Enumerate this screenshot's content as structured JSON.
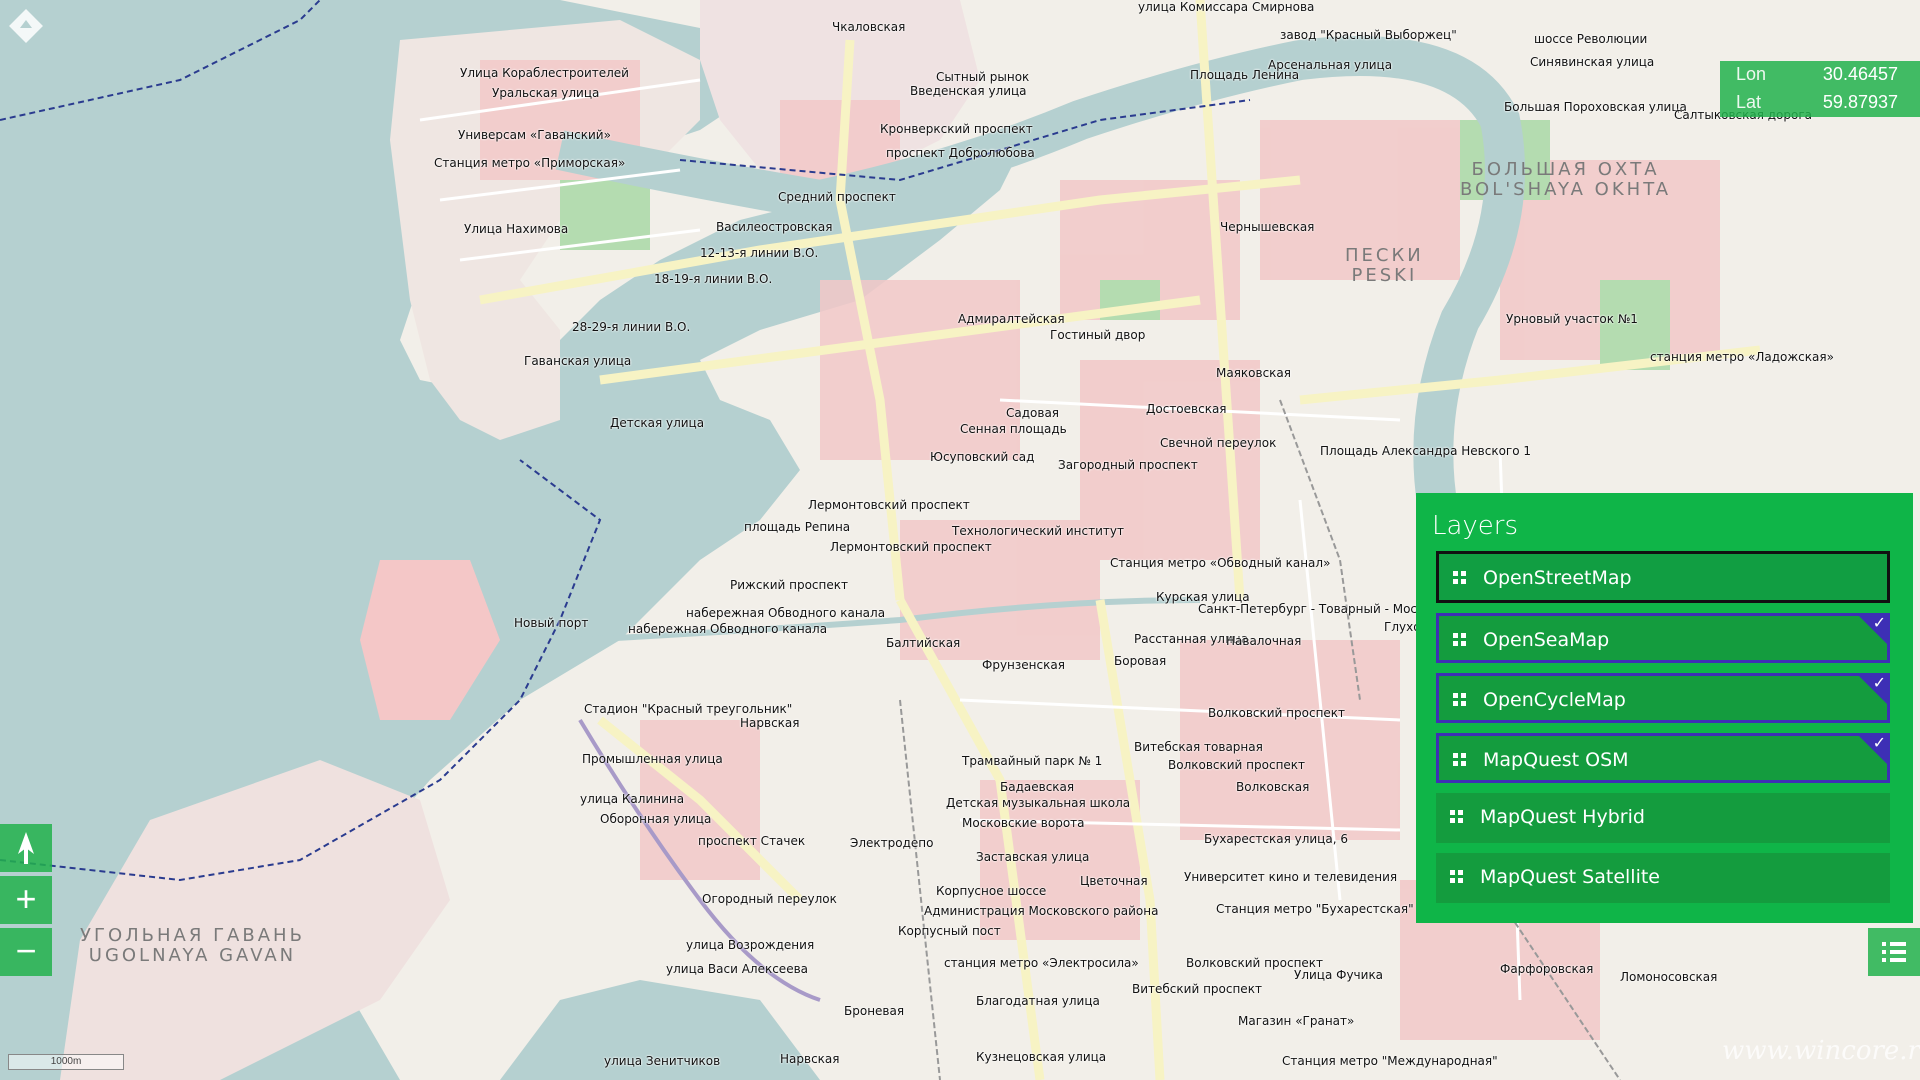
{
  "coordinates": {
    "lon_label": "Lon",
    "lon_value": "30.46457",
    "lat_label": "Lat",
    "lat_value": "59.87937"
  },
  "layers_panel": {
    "title": "Layers",
    "items": [
      {
        "label": "OpenStreetMap",
        "state": "selected"
      },
      {
        "label": "OpenSeaMap",
        "state": "checked"
      },
      {
        "label": "OpenCycleMap",
        "state": "checked"
      },
      {
        "label": "MapQuest OSM",
        "state": "checked"
      },
      {
        "label": "MapQuest Hybrid",
        "state": "normal"
      },
      {
        "label": "MapQuest Satellite",
        "state": "normal"
      }
    ]
  },
  "controls": {
    "zoom_in": "+",
    "zoom_out": "−",
    "north_arrow_icon": "north-arrow-icon",
    "layers_icon": "list-icon"
  },
  "scale": "1000m",
  "watermark": "www.wincore.ru",
  "map": {
    "districts": [
      {
        "name": "БОЛЬШАЯ ОХТА",
        "name2": "BOL'SHAYA OKHTA"
      },
      {
        "name": "ПЕСКИ",
        "name2": "PESKI"
      },
      {
        "name": "УГОЛЬНАЯ ГАВАНЬ",
        "name2": "UGOLNAYA GAVAN"
      }
    ],
    "labels": [
      "улица Комиссара Смирнова",
      "завод \"Красный Выборжец\"",
      "шоссе Революции",
      "Чкаловская",
      "Синявинская улица",
      "Улица Кораблестроителей",
      "Арсенальная улица",
      "Площадь Ленина",
      "Сытный рынок",
      "Введенская улица",
      "Уральская улица",
      "Большая Пороховская улица",
      "Салтыковская дорога",
      "Универсам «Гаванский»",
      "Кронверкский проспект",
      "Станция метро «Приморская»",
      "проспект Добролюбова",
      "Средний проспект",
      "Улица Нахимова",
      "Василеостровская",
      "12-13-я линии В.О.",
      "18-19-я линии В.О.",
      "Чернышевская",
      "28-29-я линии В.О.",
      "Гаванская улица",
      "Адмиралтейская",
      "Гостиный двор",
      "Урновый участок №1",
      "Маяковская",
      "станция метро «Ладожская»",
      "Детская улица",
      "Садовая",
      "Достоевская",
      "Сенная площадь",
      "Свечной переулок",
      "Юсуповский сад",
      "Загородный проспект",
      "Площадь Александра Невского 1",
      "Лермонтовский проспект",
      "площадь Репина",
      "Технологический институт",
      "Лермонтовский проспект",
      "Станция метро «Обводный канал»",
      "Рижский проспект",
      "Курская улица",
      "набережная Обводного канала",
      "Санкт-Петербург - Товарный - Московс",
      "Новый порт",
      "набережная Обводного канала",
      "Глухо",
      "Балтийская",
      "Расстанная улица",
      "Навалочная",
      "Фрунзенская",
      "Боровая",
      "Стадион \"Красный треугольник\"",
      "Нарвская",
      "Волковский проспект",
      "Промышленная улица",
      "Витебская товарная",
      "Трамвайный парк № 1",
      "Волковский проспект",
      "Бадаевская",
      "Волковская",
      "улица Калинина",
      "Оборонная улица",
      "Детская музыкальная школа",
      "Московские ворота",
      "проспект Стачек",
      "Электродепо",
      "Бухарестская улица, 6",
      "Заставская улица",
      "Цветочная",
      "Университет кино и телевидения",
      "Огородный переулок",
      "Корпусное шоссе",
      "Администрация Московского района",
      "Станция метро \"Бухарестская\"",
      "Корпусный пост",
      "улица Возрождения",
      "станция метро «Электросила»",
      "Волковский проспект",
      "Фарфоровская",
      "улица Васи Алексеева",
      "Улица Фучика",
      "Ломоносовская",
      "Витебский проспект",
      "Благодатная улица",
      "Броневая",
      "Магазин «Гранат»",
      "улица Зенитчиков",
      "Нарвская",
      "Кузнецовская улица",
      "Станция метро \"Международная\""
    ]
  }
}
